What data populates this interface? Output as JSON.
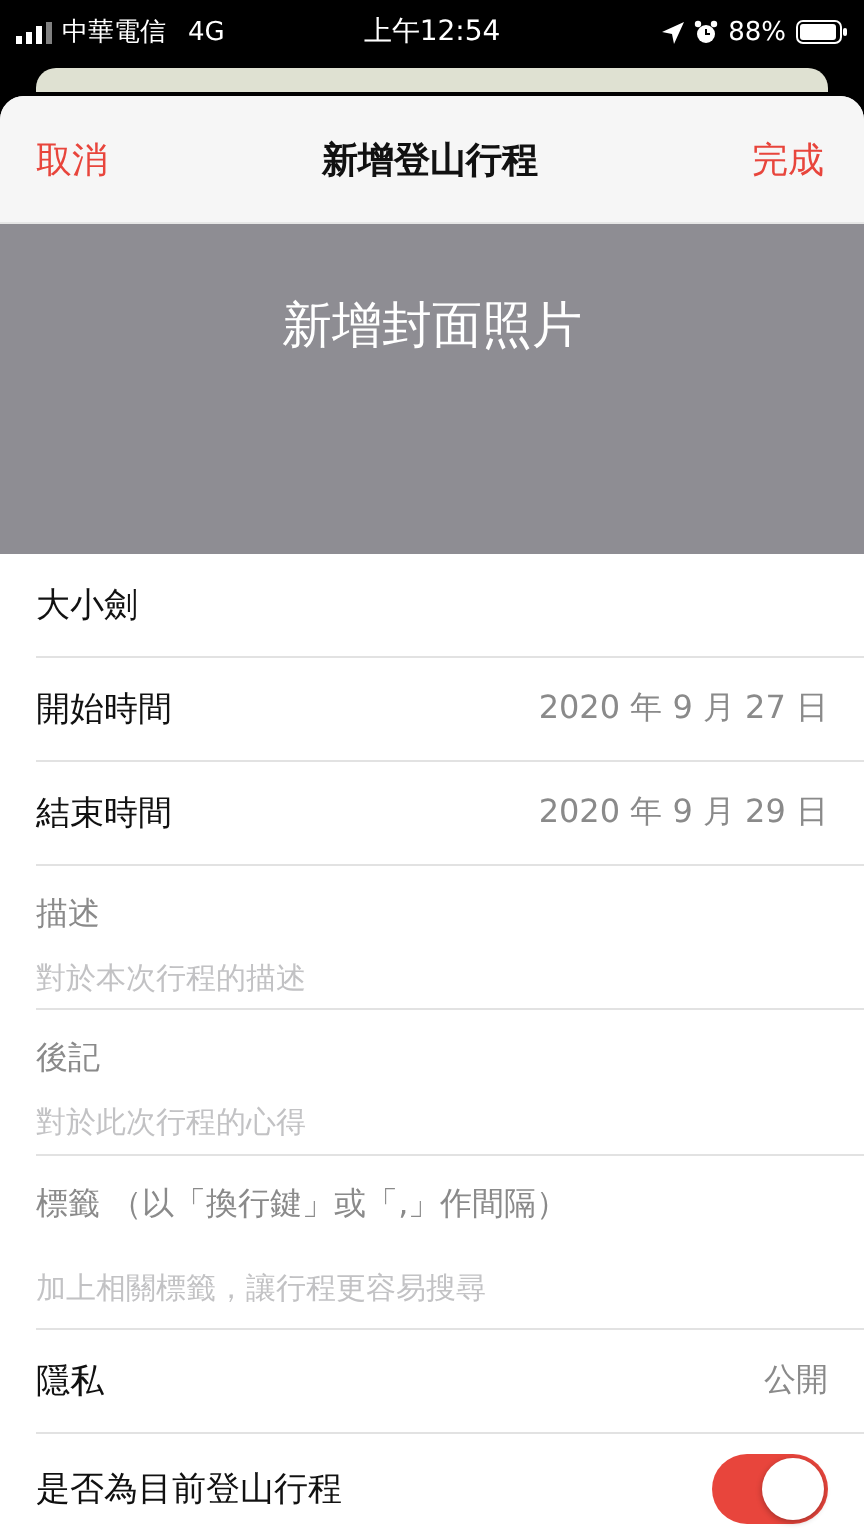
{
  "status_bar": {
    "carrier": "中華電信",
    "network": "4G",
    "time": "上午12:54",
    "battery": "88%"
  },
  "nav": {
    "cancel": "取消",
    "title": "新增登山行程",
    "done": "完成"
  },
  "cover": {
    "label": "新增封面照片"
  },
  "rows": [
    {
      "kind": "input",
      "value": "大小劍"
    },
    {
      "kind": "value",
      "label": "開始時間",
      "value": "2020 年 9 月 27 日"
    },
    {
      "kind": "value",
      "label": "結束時間",
      "value": "2020 年 9 月 29 日"
    },
    {
      "kind": "note",
      "label": "描述",
      "placeholder": "對於本次行程的描述"
    },
    {
      "kind": "note",
      "label": "後記",
      "placeholder": "對於此次行程的心得"
    },
    {
      "kind": "note",
      "label": "標籤 （以「換行鍵」或「,」作間隔）",
      "placeholder": "加上相關標籤，讓行程更容易搜尋"
    },
    {
      "kind": "value",
      "label": "隱私",
      "value": "公開"
    },
    {
      "kind": "toggle",
      "label": "是否為目前登山行程",
      "on": true
    }
  ]
}
